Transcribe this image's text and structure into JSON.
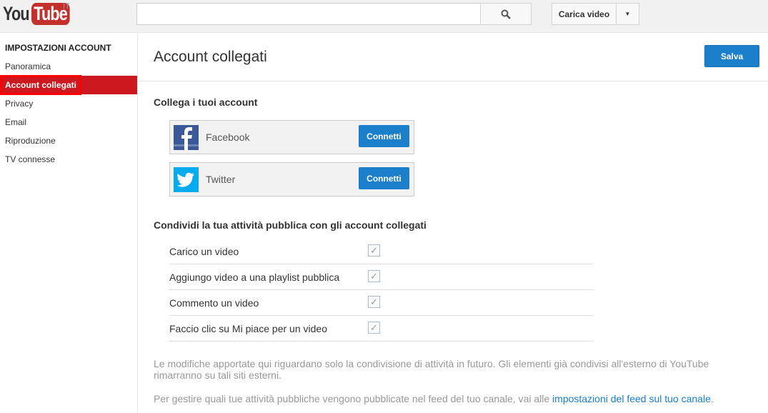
{
  "header": {
    "logo_you": "You",
    "logo_tube": "Tube",
    "country": "IT",
    "search_placeholder": "",
    "upload_label": "Carica video"
  },
  "sidebar": {
    "title": "IMPOSTAZIONI ACCOUNT",
    "items": [
      {
        "label": "Panoramica"
      },
      {
        "label": "Account collegati",
        "active": true
      },
      {
        "label": "Privacy"
      },
      {
        "label": "Email"
      },
      {
        "label": "Riproduzione"
      },
      {
        "label": "TV connesse"
      }
    ]
  },
  "main": {
    "title": "Account collegati",
    "save_label": "Salva",
    "link_heading": "Collega i tuoi account",
    "accounts": [
      {
        "name": "Facebook",
        "icon": "facebook-icon",
        "button": "Connetti"
      },
      {
        "name": "Twitter",
        "icon": "twitter-icon",
        "button": "Connetti"
      }
    ],
    "share_heading": "Condividi la tua attività pubblica con gli account collegati",
    "options": [
      {
        "label": "Carico un video",
        "checked": true
      },
      {
        "label": "Aggiungo video a una playlist pubblica",
        "checked": true
      },
      {
        "label": "Commento un video",
        "checked": true
      },
      {
        "label": "Faccio clic su Mi piace per un video",
        "checked": true
      }
    ],
    "note1": "Le modifiche apportate qui riguardano solo la condivisione di attività in futuro. Gli elementi già condivisi all'esterno di YouTube rimarranno su tali siti esterni.",
    "note2_prefix": "Per gestire quali tue attività pubbliche vengono pubblicate nel feed del tuo canale, vai alle ",
    "note2_link": "impostazioni del feed sul tuo canale",
    "note2_suffix": "."
  },
  "colors": {
    "accent": "#1b7fcc",
    "active_nav": "#cc181e",
    "facebook": "#3b5998",
    "twitter": "#00acee"
  }
}
